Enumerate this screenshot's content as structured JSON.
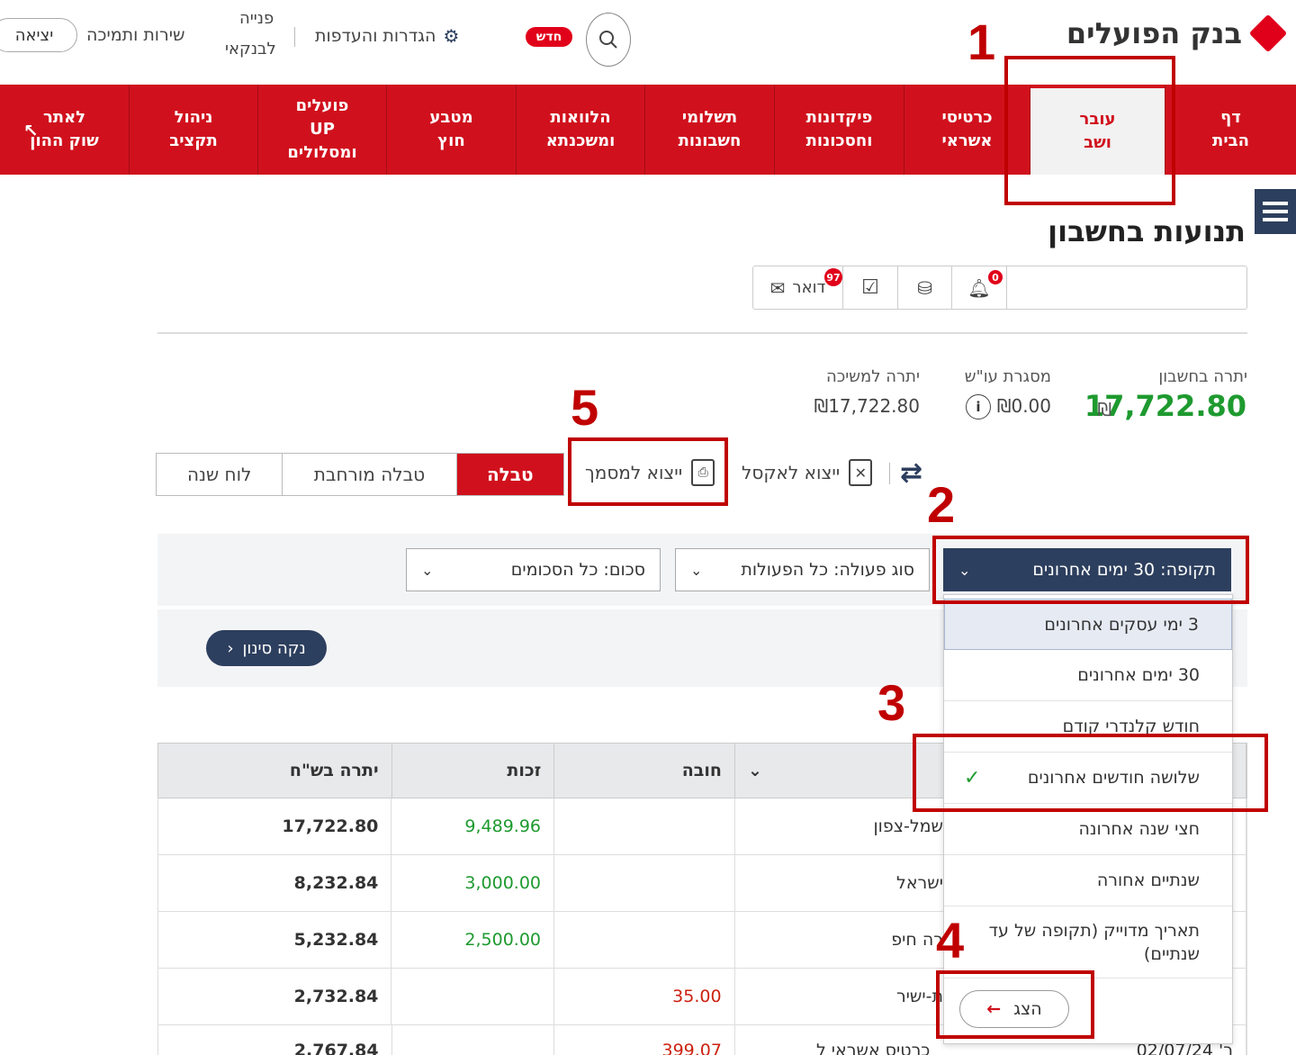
{
  "header": {
    "bank_name": "בנק הפועלים",
    "exit": "יציאה",
    "service": "שירות ותמיכה",
    "contact_line1": "פנייה",
    "contact_line2": "לבנקאי",
    "settings": "הגדרות והעדפות",
    "new_badge": "חדש"
  },
  "nav": [
    {
      "label": "דף\nהבית"
    },
    {
      "label": "עובר\nושב"
    },
    {
      "label": "כרטיסי\nאשראי"
    },
    {
      "label": "פיקדונות\nוחסכונות"
    },
    {
      "label": "תשלומי\nחשבונות"
    },
    {
      "label": "הלוואות\nומשכנתא"
    },
    {
      "label": "מטבע\nחוץ"
    },
    {
      "label": "פועלים\nUP\nומסלולים"
    },
    {
      "label": "ניהול\nתקציב"
    },
    {
      "label": "לאתר\nשוק ההון"
    }
  ],
  "page": {
    "title": "תנועות בחשבון"
  },
  "toolbar": {
    "mail_label": "דואר",
    "mail_badge": "97",
    "bell_badge": "0"
  },
  "balances": {
    "account_label": "יתרה בחשבון",
    "account_value": "17,722.80",
    "account_currency": "₪",
    "credit_label": "מסגרת עו\"ש",
    "credit_value": "₪0.00",
    "withdraw_label": "יתרה למשיכה",
    "withdraw_value": "₪17,722.80"
  },
  "views": {
    "table": "טבלה",
    "extended": "טבלה מורחבת",
    "calendar": "לוח שנה"
  },
  "actions": {
    "export_pdf": "ייצוא למסמך",
    "export_excel": "ייצוא לאקסל"
  },
  "filters": {
    "period": "תקופה: 30 ימים אחרונים",
    "type": "סוג פעולה: כל הפעולות",
    "amount": "סכום: כל הסכומים",
    "clear": "נקה סינון"
  },
  "dropdown": {
    "options": [
      "3 ימי עסקים אחרונים",
      "30 ימים אחרונים",
      "חודש קלנדרי קודם",
      "שלושה חודשים אחרונים",
      "חצי שנה אחרונה",
      "שנתיים אחורה",
      "תאריך מדוייק (תקופה של עד שנתיים)"
    ],
    "check": "✓",
    "show_button": "הצג"
  },
  "table": {
    "headers": {
      "balance": "יתרה בש\"ח",
      "credit": "זכות",
      "debit": "חובה"
    },
    "rows": [
      {
        "balance": "17,722.80",
        "credit": "9,489.96",
        "debit": "",
        "desc": "שמל-צפון"
      },
      {
        "balance": "8,232.84",
        "credit": "3,000.00",
        "debit": "",
        "desc": "ישראל"
      },
      {
        "balance": "5,232.84",
        "credit": "2,500.00",
        "debit": "",
        "desc": "רה חיפ"
      },
      {
        "balance": "2,732.84",
        "credit": "",
        "debit": "35.00",
        "desc": "ת-ישיר"
      },
      {
        "balance": "2,767.84",
        "credit": "",
        "debit": "399.07",
        "desc": "כרטיס אשראי ל",
        "date": "ר' 02/07/24"
      }
    ]
  },
  "steps": [
    "1",
    "2",
    "3",
    "4",
    "5"
  ],
  "colors": {
    "brand_red": "#d0111d",
    "navy": "#2d3f5e",
    "positive": "#1e9a2f",
    "annotation": "#c00000"
  }
}
